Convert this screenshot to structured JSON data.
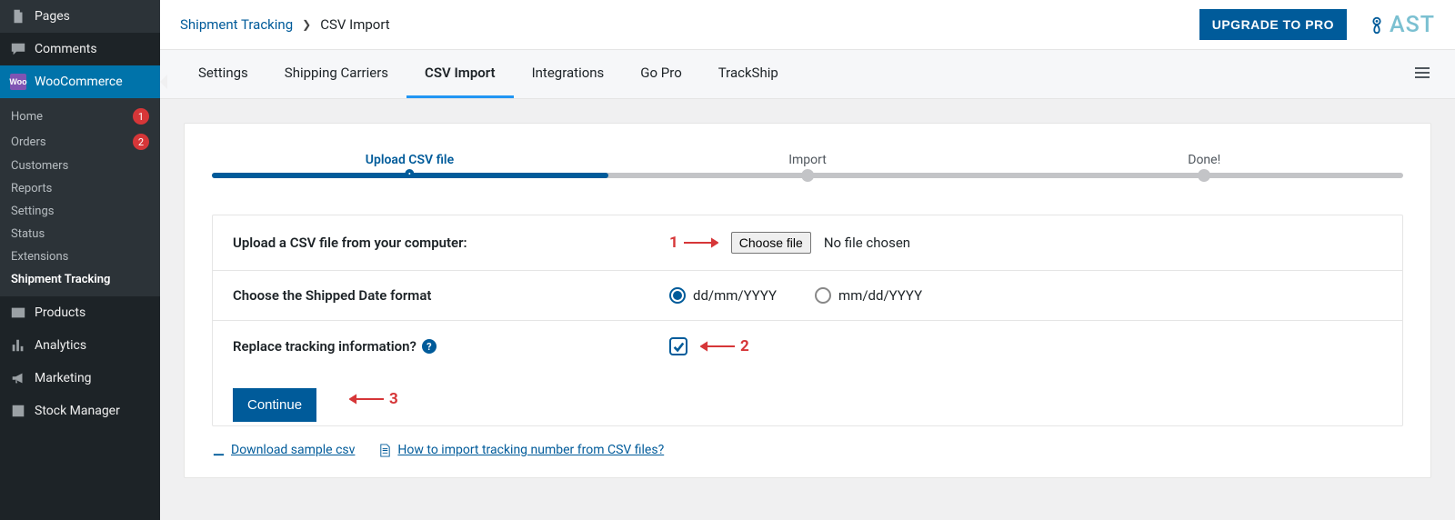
{
  "sidebar": {
    "items": [
      {
        "label": "Pages"
      },
      {
        "label": "Comments"
      },
      {
        "label": "WooCommerce"
      },
      {
        "label": "Products"
      },
      {
        "label": "Analytics"
      },
      {
        "label": "Marketing"
      },
      {
        "label": "Stock Manager"
      }
    ],
    "woo_sub": [
      {
        "label": "Home",
        "badge": "1"
      },
      {
        "label": "Orders",
        "badge": "2"
      },
      {
        "label": "Customers"
      },
      {
        "label": "Reports"
      },
      {
        "label": "Settings"
      },
      {
        "label": "Status"
      },
      {
        "label": "Extensions"
      },
      {
        "label": "Shipment Tracking"
      }
    ]
  },
  "breadcrumb": {
    "root": "Shipment Tracking",
    "current": "CSV Import"
  },
  "topbar": {
    "upgrade": "UPGRADE TO PRO",
    "logo_text": "AST"
  },
  "tabs": [
    "Settings",
    "Shipping Carriers",
    "CSV Import",
    "Integrations",
    "Go Pro",
    "TrackShip"
  ],
  "stepper": {
    "steps": [
      "Upload CSV file",
      "Import",
      "Done!"
    ]
  },
  "form": {
    "upload_label": "Upload a CSV file from your computer:",
    "choose_file_btn": "Choose file",
    "no_file_text": "No file chosen",
    "date_format_label": "Choose the Shipped Date format",
    "date_option_1": "dd/mm/YYYY",
    "date_option_2": "mm/dd/YYYY",
    "replace_label": "Replace tracking information?",
    "continue_btn": "Continue"
  },
  "annotations": {
    "a1": "1",
    "a2": "2",
    "a3": "3"
  },
  "links": {
    "download_sample": "Download sample csv",
    "how_to": "How to import tracking number from CSV files?"
  }
}
